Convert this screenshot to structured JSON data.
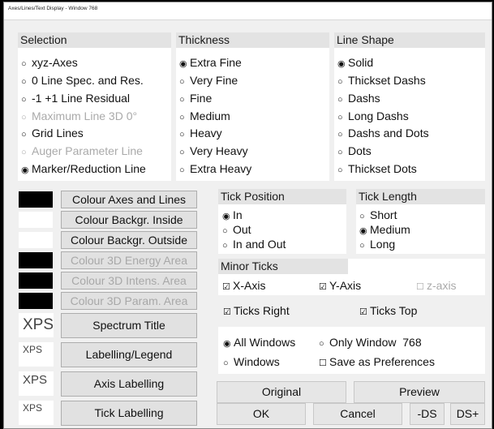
{
  "window": {
    "title": "Axes/Lines/Text Display - Window 768"
  },
  "selection": {
    "header": "Selection",
    "items": [
      {
        "label": "xyz-Axes",
        "selected": false,
        "enabled": true
      },
      {
        "label": "0 Line Spec. and Res.",
        "selected": false,
        "enabled": true
      },
      {
        "label": "-1 +1 Line Residual",
        "selected": false,
        "enabled": true
      },
      {
        "label": "Maximum Line 3D 0°",
        "selected": false,
        "enabled": false
      },
      {
        "label": "Grid Lines",
        "selected": false,
        "enabled": true
      },
      {
        "label": "Auger Parameter Line",
        "selected": false,
        "enabled": false
      },
      {
        "label": "Marker/Reduction Line",
        "selected": true,
        "enabled": true
      }
    ]
  },
  "thickness": {
    "header": "Thickness",
    "items": [
      {
        "label": "Extra Fine",
        "selected": true
      },
      {
        "label": "Very Fine",
        "selected": false
      },
      {
        "label": "Fine",
        "selected": false
      },
      {
        "label": "Medium",
        "selected": false
      },
      {
        "label": "Heavy",
        "selected": false
      },
      {
        "label": "Very Heavy",
        "selected": false
      },
      {
        "label": "Extra Heavy",
        "selected": false
      }
    ]
  },
  "line_shape": {
    "header": "Line Shape",
    "items": [
      {
        "label": "Solid",
        "selected": true
      },
      {
        "label": "Thickset Dashs",
        "selected": false
      },
      {
        "label": "Dashs",
        "selected": false
      },
      {
        "label": "Long Dashs",
        "selected": false
      },
      {
        "label": "Dashs and Dots",
        "selected": false
      },
      {
        "label": "Dots",
        "selected": false
      },
      {
        "label": "Thickset Dots",
        "selected": false
      }
    ]
  },
  "colours": [
    {
      "label": "Colour Axes and Lines",
      "swatch": "#000000",
      "enabled": true
    },
    {
      "label": "Colour Backgr. Inside",
      "swatch": "#ffffff",
      "enabled": true
    },
    {
      "label": "Colour Backgr. Outside",
      "swatch": "#ffffff",
      "enabled": true
    },
    {
      "label": "Colour 3D Energy Area",
      "swatch": "#000000",
      "enabled": false
    },
    {
      "label": "Colour 3D Intens. Area",
      "swatch": "#000000",
      "enabled": false
    },
    {
      "label": "Colour 3D Param. Area",
      "swatch": "#000000",
      "enabled": false
    }
  ],
  "fonts": [
    {
      "sample": "XPS",
      "label": "Spectrum Title"
    },
    {
      "sample": "XPS",
      "label": "Labelling/Legend"
    },
    {
      "sample": "XPS",
      "label": "Axis Labelling"
    },
    {
      "sample": "XPS",
      "label": "Tick Labelling"
    }
  ],
  "tick_position": {
    "header": "Tick Position",
    "items": [
      {
        "label": "In",
        "selected": true
      },
      {
        "label": "Out",
        "selected": false
      },
      {
        "label": "In and Out",
        "selected": false
      }
    ]
  },
  "tick_length": {
    "header": "Tick Length",
    "items": [
      {
        "label": "Short",
        "selected": false
      },
      {
        "label": "Medium",
        "selected": true
      },
      {
        "label": "Long",
        "selected": false
      }
    ]
  },
  "minor_ticks": {
    "header": "Minor Ticks",
    "x_axis": {
      "label": "X-Axis",
      "checked": true
    },
    "y_axis": {
      "label": "Y-Axis",
      "checked": true
    },
    "z_axis": {
      "label": "z-axis",
      "checked": false
    }
  },
  "ticks_right": {
    "label": "Ticks Right",
    "checked": true
  },
  "ticks_top": {
    "label": "Ticks Top",
    "checked": true
  },
  "apply": {
    "all_windows": {
      "label": "All Windows",
      "selected": true
    },
    "only_window": {
      "label": "Only Window",
      "number": "768",
      "selected": false
    },
    "windows": {
      "label": "Windows",
      "selected": false
    },
    "save_prefs": {
      "label": "Save as Preferences",
      "checked": false
    }
  },
  "buttons": {
    "original": "Original",
    "preview": "Preview",
    "ok": "OK",
    "cancel": "Cancel",
    "minus_ds": "-DS",
    "plus_ds": "DS+"
  },
  "symbols": {
    "radio_on": "◉",
    "radio_off": "○",
    "check_on": "☑",
    "check_off": "☐"
  }
}
